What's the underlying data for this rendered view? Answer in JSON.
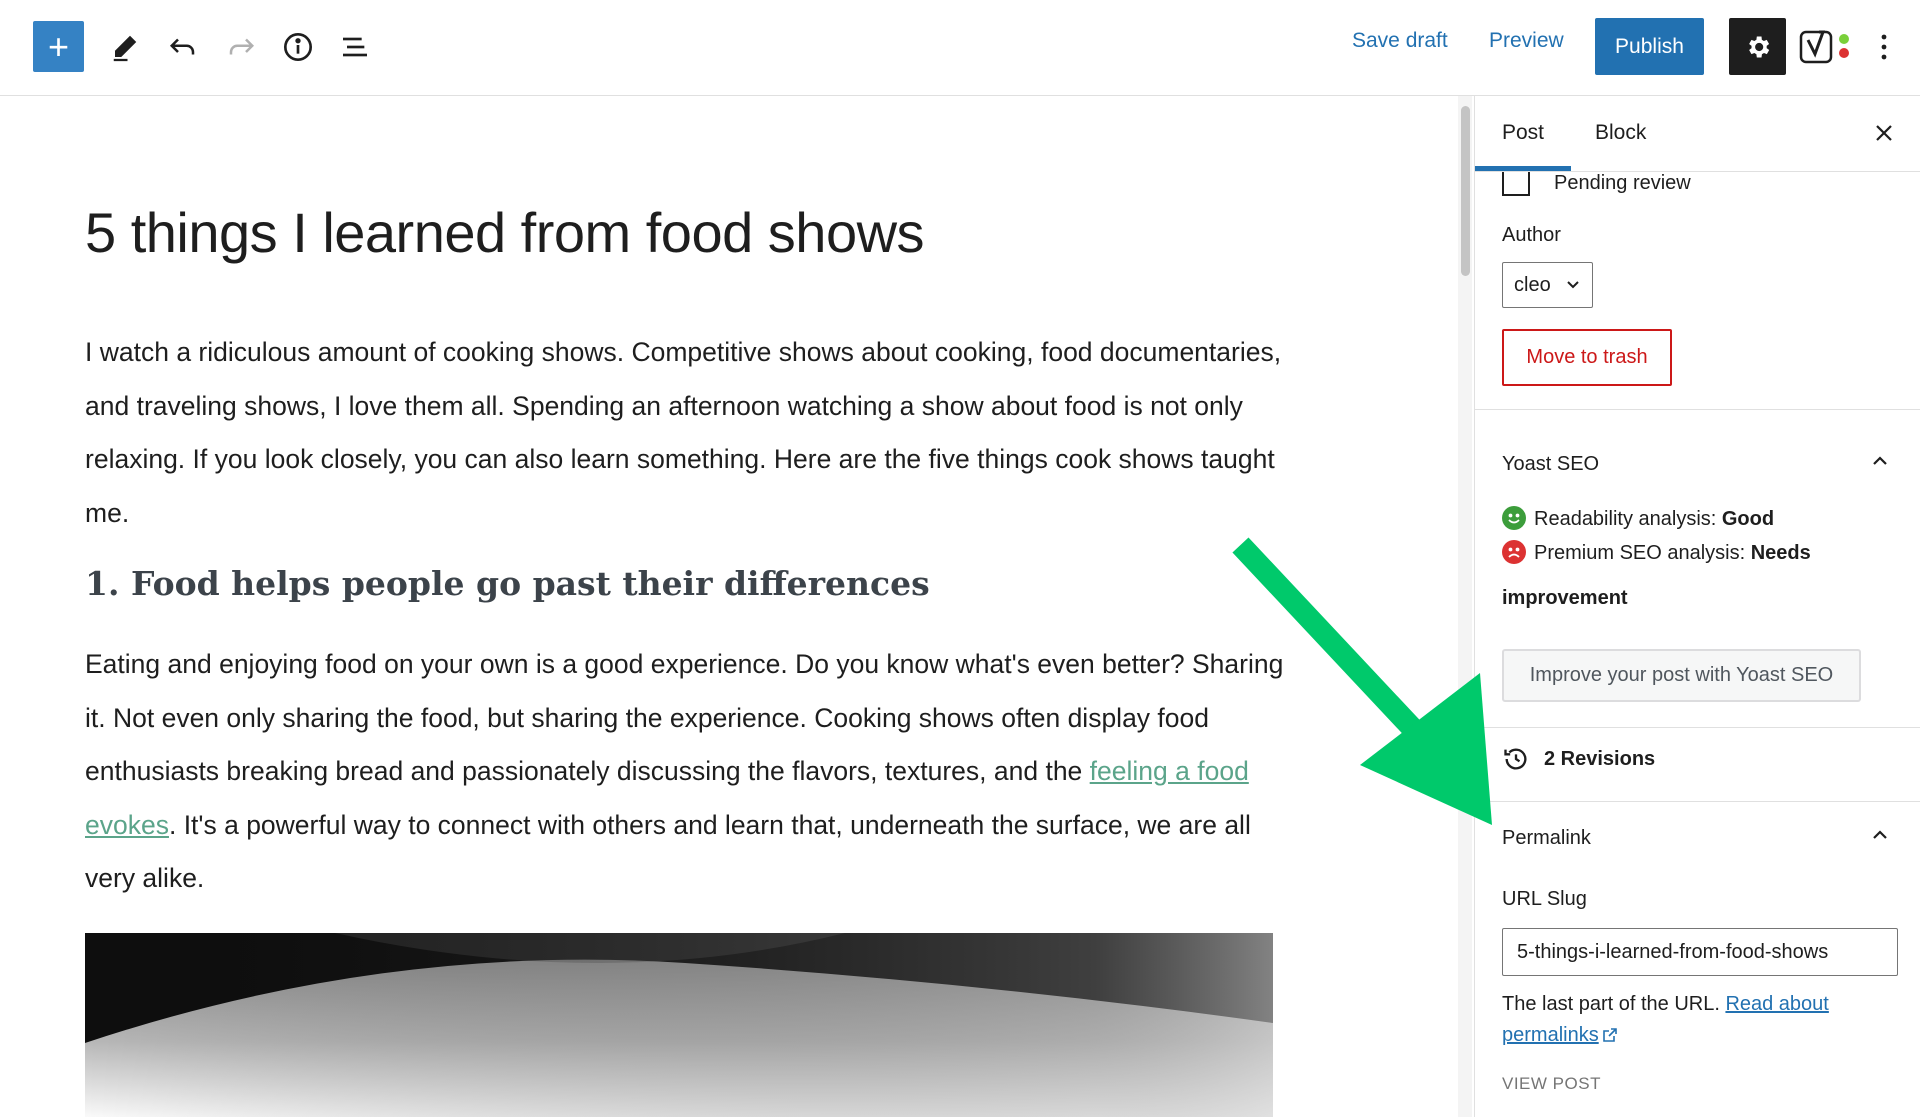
{
  "toolbar": {
    "add_label": "+",
    "save_draft": "Save draft",
    "preview": "Preview",
    "publish": "Publish"
  },
  "editor": {
    "title": "5 things I learned from food shows",
    "p1": "I watch a ridiculous amount of cooking shows. Competitive shows about cooking, food documentaries, and traveling shows, I love them all. Spending an afternoon watching a show about food is not only relaxing. If you look closely, you can also learn something. Here are the five things cook shows taught me.",
    "heading": "1. Food helps people go past their differences",
    "p2_before": "Eating and enjoying food on your own is a good experience. Do you know what's even better? Sharing it. Not even only sharing the food, but sharing the experience. Cooking shows often display food enthusiasts breaking bread and passionately discussing the flavors, textures, and the ",
    "p2_link": "feeling a food evokes",
    "p2_after": ". It's a powerful way to connect with others and learn that, underneath the surface, we are all very alike."
  },
  "sidebar": {
    "tab_post": "Post",
    "tab_block": "Block",
    "pending_review": "Pending review",
    "author_label": "Author",
    "author_value": "cleo",
    "move_to_trash": "Move to trash",
    "yoast_title": "Yoast SEO",
    "readability_label": "Readability analysis: ",
    "readability_value": "Good",
    "seo_label": "Premium SEO analysis: ",
    "seo_value": "Needs",
    "seo_value_2": "improvement",
    "improve_button": "Improve your post with Yoast SEO",
    "revisions": "2 Revisions",
    "permalink_title": "Permalink",
    "url_slug_label": "URL Slug",
    "url_slug_value": "5-things-i-learned-from-food-shows",
    "slug_help": "The last part of the URL. ",
    "slug_help_link_1": "Read about",
    "slug_help_link_2": "permalinks",
    "view_post": "VIEW POST"
  },
  "colors": {
    "accent": "#2271b1",
    "add_button": "#3582c4",
    "trash": "#cc1818",
    "link_green": "#5ba48a",
    "arrow": "#00c96b"
  },
  "icons": [
    "plus-icon",
    "pencil-icon",
    "undo-icon",
    "redo-icon",
    "info-icon",
    "list-view-icon",
    "gear-icon",
    "yoast-logo-icon",
    "more-vertical-icon",
    "close-icon",
    "chevron-down-icon",
    "chevron-up-icon",
    "smiley-good-icon",
    "smiley-bad-icon",
    "revisions-icon",
    "external-link-icon"
  ]
}
